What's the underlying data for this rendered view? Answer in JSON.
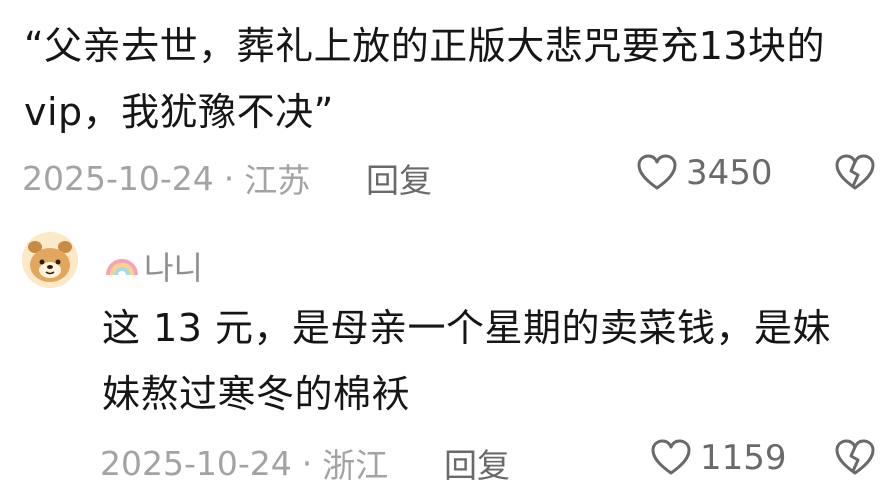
{
  "comment1": {
    "line1": "“父亲去世，葬礼上放的正版大悲咒要充13块的",
    "line2": "vip，我犹豫不决”",
    "date": "2025-10-24",
    "location": "江苏",
    "reply_label": "回复",
    "likes": "3450"
  },
  "comment2": {
    "username": "나니",
    "line1": "这 13 元，是母亲一个星期的卖菜钱，是妹",
    "line2": "妹熬过寒冬的棉袄",
    "date": "2025-10-24",
    "location": "浙江",
    "reply_label": "回复",
    "likes": "1159"
  },
  "separator": "·",
  "icons": {
    "like": "heart-outline-icon",
    "dislike": "broken-heart-icon",
    "username_prefix": "rainbow-icon"
  }
}
